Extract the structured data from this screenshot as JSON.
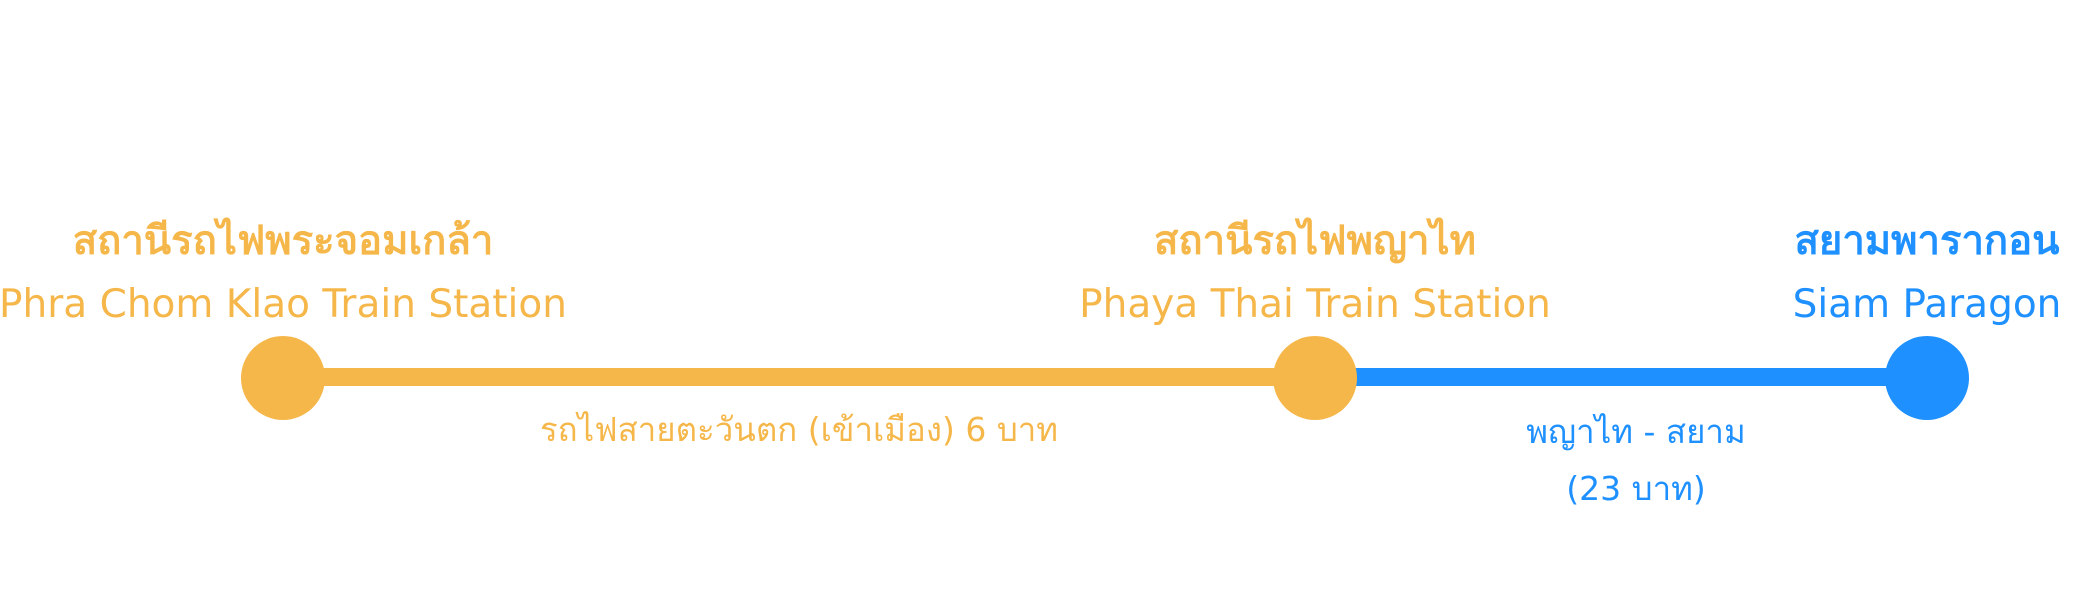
{
  "colors": {
    "line_1": "#F6B74A",
    "line_2": "#1E90FF"
  },
  "stations": [
    {
      "thai": "สถานีรถไฟพระจอมเกล้า",
      "english": "Phra Chom Klao Train Station",
      "color": "#F6B74A"
    },
    {
      "thai": "สถานีรถไฟพญาไท",
      "english": "Phaya Thai Train Station",
      "color": "#F6B74A"
    },
    {
      "thai": "สยามพารากอน",
      "english": "Siam Paragon",
      "color": "#1E90FF"
    }
  ],
  "segments": [
    {
      "label": "รถไฟสายตะวันตก (เข้าเมือง) 6 บาท",
      "color": "#F6B74A"
    },
    {
      "label": "พญาไท - สยาม",
      "fare": "(23 บาท)",
      "color": "#1E90FF"
    }
  ]
}
